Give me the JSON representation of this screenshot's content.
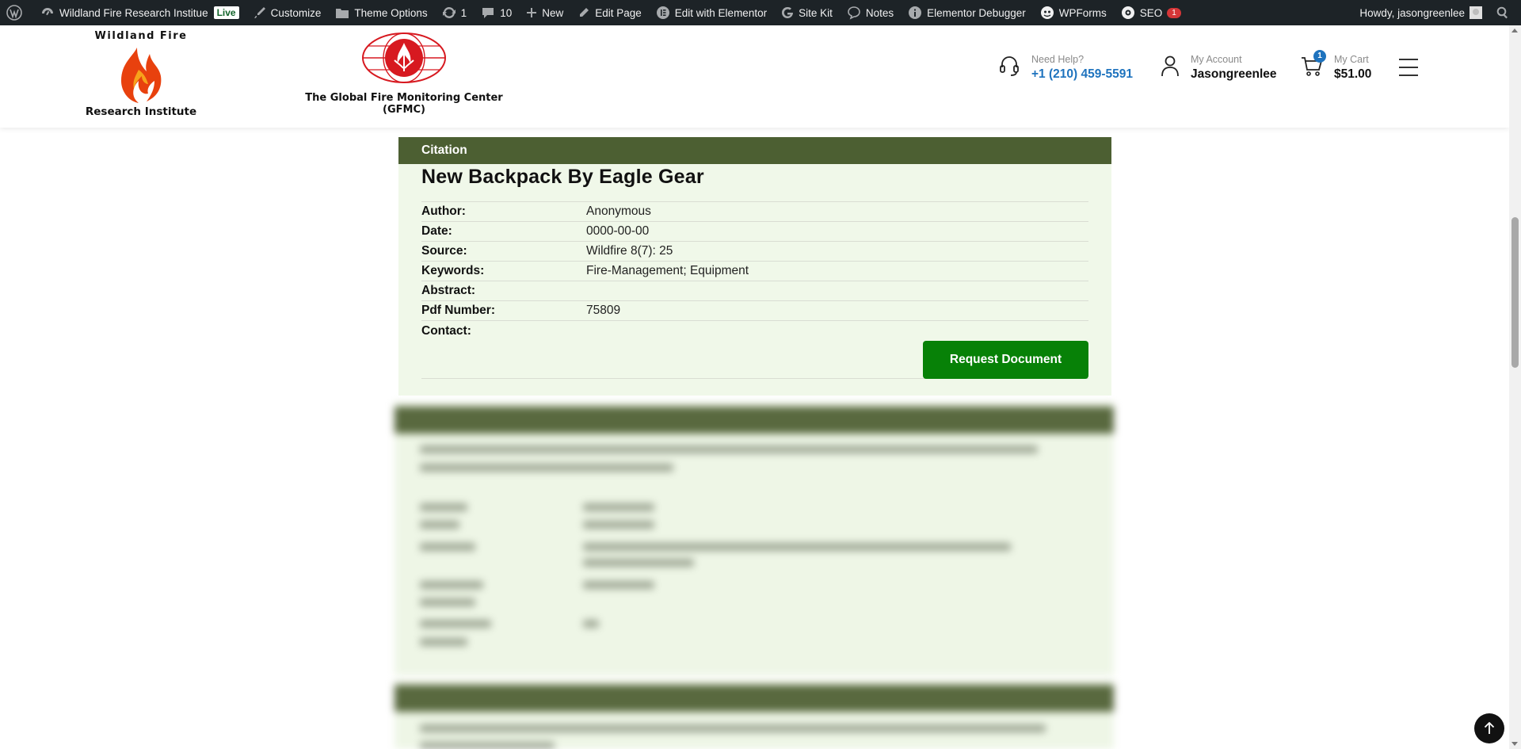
{
  "adminbar": {
    "site_name": "Wildland Fire Research Institue",
    "live_badge": "Live",
    "customize": "Customize",
    "theme_options": "Theme Options",
    "updates_count": "1",
    "comments_count": "10",
    "new": "New",
    "edit_page": "Edit Page",
    "edit_elementor": "Edit with Elementor",
    "site_kit": "Site Kit",
    "notes": "Notes",
    "elementor_debugger": "Elementor Debugger",
    "wpforms": "WPForms",
    "seo": "SEO",
    "seo_count": "1",
    "howdy": "Howdy, jasongreenlee"
  },
  "header": {
    "logo1_top": "Wildland Fire",
    "logo1_bottom": "Research Institute",
    "logo2_caption": "The Global Fire Monitoring Center (GFMC)",
    "help_label": "Need Help?",
    "help_phone": "+1 (210) 459-5591",
    "account_label": "My Account",
    "account_name": "Jasongreenlee",
    "cart_label": "My Cart",
    "cart_total": "$51.00",
    "cart_count": "1"
  },
  "citation": {
    "header": "Citation",
    "title": "New Backpack By Eagle Gear",
    "fields": [
      {
        "label": "Author:",
        "value": "Anonymous"
      },
      {
        "label": "Date:",
        "value": "0000-00-00"
      },
      {
        "label": "Source:",
        "value": "Wildfire 8(7): 25"
      },
      {
        "label": "Keywords:",
        "value": "Fire-Management; Equipment"
      },
      {
        "label": "Abstract:",
        "value": ""
      },
      {
        "label": "Pdf Number:",
        "value": "75809"
      },
      {
        "label": "Contact:",
        "value": ""
      }
    ],
    "button": "Request Document"
  },
  "colors": {
    "card_header": "#4c5f32",
    "card_bg": "#f0f8e9",
    "button": "#078107",
    "link": "#1e73be"
  }
}
